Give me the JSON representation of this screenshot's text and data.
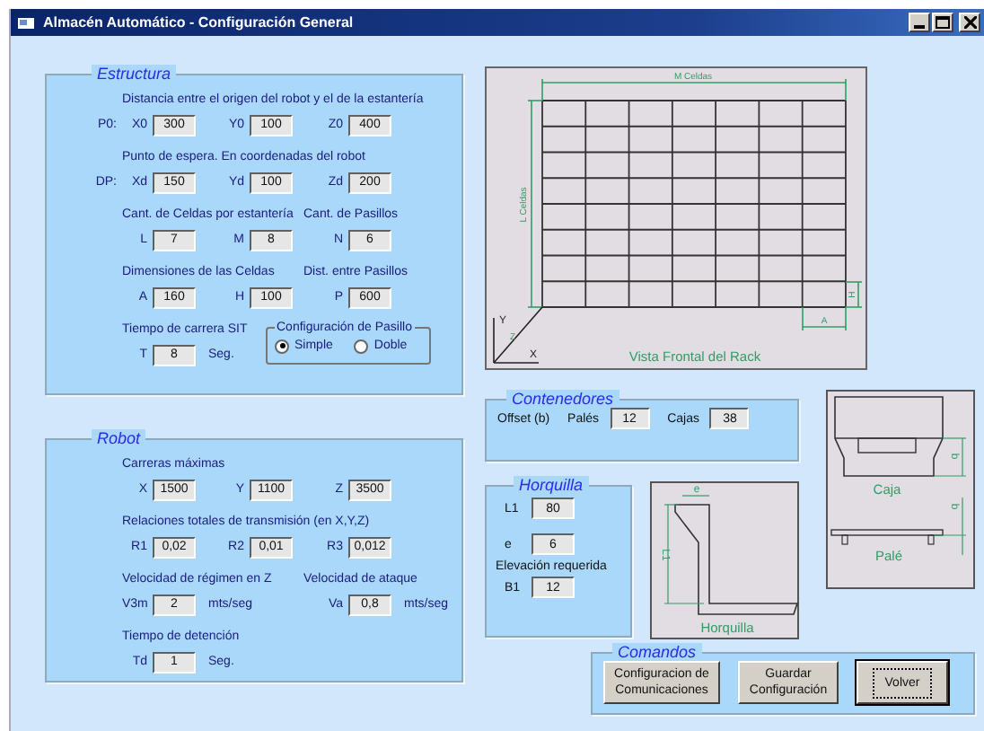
{
  "window": {
    "title": "Almacén Automático - Configuración General"
  },
  "estructura": {
    "title": "Estructura",
    "groups": [
      {
        "caption": "Distancia entre el origen del robot y el de la estantería",
        "prefix": "P0:",
        "fields": [
          {
            "label": "X0",
            "value": "300"
          },
          {
            "label": "Y0",
            "value": "100"
          },
          {
            "label": "Z0",
            "value": "400"
          }
        ]
      },
      {
        "caption": "Punto de espera. En coordenadas del robot",
        "prefix": "DP:",
        "fields": [
          {
            "label": "Xd",
            "value": "150"
          },
          {
            "label": "Yd",
            "value": "100"
          },
          {
            "label": "Zd",
            "value": "200"
          }
        ]
      },
      {
        "caption": "Cant. de Celdas por estantería",
        "caption_2": "Cant. de Pasillos",
        "fields": [
          {
            "label": "L",
            "value": "7"
          },
          {
            "label": "M",
            "value": "8"
          },
          {
            "label": "N",
            "value": "6"
          }
        ]
      },
      {
        "caption": "Dimensiones de las Celdas",
        "caption_2": "Dist. entre Pasillos",
        "fields": [
          {
            "label": "A",
            "value": "160"
          },
          {
            "label": "H",
            "value": "100"
          },
          {
            "label": "P",
            "value": "600"
          }
        ]
      },
      {
        "caption": "Tiempo de carrera SIT",
        "fields": [
          {
            "label": "T",
            "value": "8",
            "unit": "Seg."
          }
        ],
        "options": {
          "title": "Configuración de Pasillo",
          "items": [
            {
              "label": "Simple",
              "selected": true
            },
            {
              "label": "Doble",
              "selected": false
            }
          ]
        }
      }
    ]
  },
  "robot": {
    "title": "Robot",
    "groups": [
      {
        "caption": "Carreras máximas",
        "fields": [
          {
            "label": "X",
            "value": "1500"
          },
          {
            "label": "Y",
            "value": "1100"
          },
          {
            "label": "Z",
            "value": "3500"
          }
        ]
      },
      {
        "caption": "Relaciones totales de transmisión (en X,Y,Z)",
        "fields": [
          {
            "label": "R1",
            "value": "0,02"
          },
          {
            "label": "R2",
            "value": "0,01"
          },
          {
            "label": "R3",
            "value": "0,012"
          }
        ]
      },
      {
        "caption": "Velocidad de régimen en Z",
        "caption_2": "Velocidad de ataque",
        "fields": [
          {
            "label": "V3m",
            "value": "2",
            "unit": "mts/seg"
          },
          {
            "label": "Va",
            "value": "0,8",
            "unit": "mts/seg"
          }
        ]
      },
      {
        "caption": "Tiempo de detención",
        "fields": [
          {
            "label": "Td",
            "value": "1",
            "unit": "Seg."
          }
        ]
      }
    ]
  },
  "rack_drawing": {
    "top_label": "M Celdas",
    "side_label": "L Celdas",
    "cell_height_label": "H",
    "cell_width_label": "A",
    "axis_y": "Y",
    "axis_x": "X",
    "axis_z": "Z",
    "caption": "Vista Frontal del Rack"
  },
  "contenedores": {
    "title": "Contenedores",
    "offset_label": "Offset (b)",
    "fields": [
      {
        "label": "Palés",
        "value": "12"
      },
      {
        "label": "Cajas",
        "value": "38"
      }
    ]
  },
  "horquilla": {
    "title": "Horquilla",
    "fields": [
      {
        "label": "L1",
        "value": "80"
      },
      {
        "label": "e",
        "value": "6"
      }
    ],
    "caption": "Elevación requerida",
    "fields_2": [
      {
        "label": "B1",
        "value": "12"
      }
    ]
  },
  "horquilla_drawing": {
    "thickness_label": "e",
    "length_label": "L1",
    "caption": "Horquilla"
  },
  "container_drawing": {
    "box_offset_label": "b",
    "box_caption": "Caja",
    "pallet_offset_label": "b",
    "pallet_caption": "Palé"
  },
  "comandos": {
    "title": "Comandos",
    "buttons": [
      {
        "label": "Configuracion de Comunicaciones",
        "focused": false
      },
      {
        "label": "Guardar Configuración",
        "focused": false
      },
      {
        "label": "Volver",
        "focused": true
      }
    ]
  }
}
